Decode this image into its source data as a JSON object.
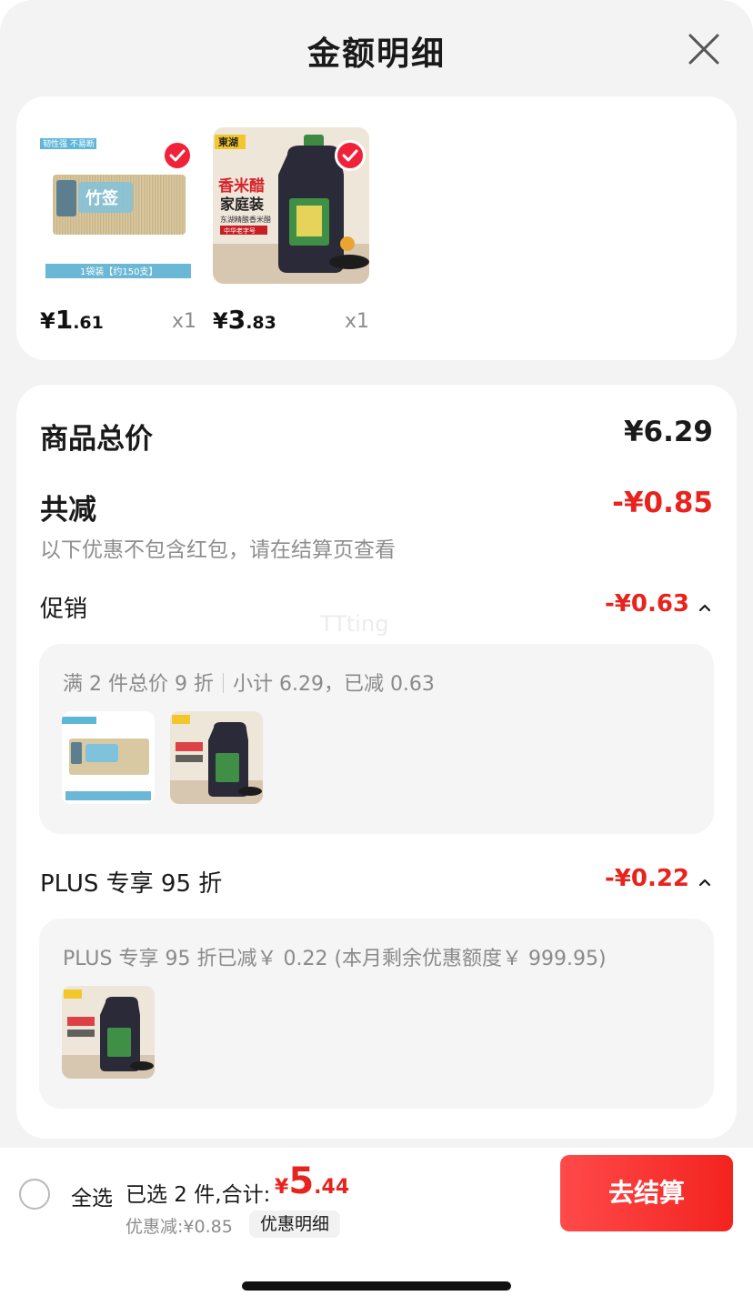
{
  "sheet": {
    "title": "金额明细"
  },
  "products": [
    {
      "name": "竹签",
      "price_symbol": "¥",
      "price_int": "1",
      "price_dec": ".61",
      "qty": "x1",
      "badge": "韧性强 不易断",
      "pack_label": "1袋装【约150支】",
      "brand": "竹签"
    },
    {
      "name": "香米醋家庭装",
      "price_symbol": "¥",
      "price_int": "3",
      "price_dec": ".83",
      "qty": "x1",
      "brand": "東湖",
      "headline1": "香米醋",
      "headline2": "家庭装",
      "sub": "东湖精酿香米醋",
      "tag": "中华老字号"
    }
  ],
  "summary": {
    "total_label": "商品总价",
    "total_value": "¥6.29",
    "reduce_label": "共减",
    "reduce_value": "-¥0.85",
    "reduce_note": "以下优惠不包含红包，请在结算页查看",
    "promo": {
      "label": "促销",
      "value": "-¥0.63",
      "rule": "满 2 件总价 9 折",
      "detail": "小计 6.29，已减 0.63"
    },
    "plus": {
      "label": "PLUS 专享 95 折",
      "value": "-¥0.22",
      "detail": "PLUS 专享 95 折已减￥ 0.22 (本月剩余优惠额度￥ 999.95)"
    }
  },
  "watermark": "TTting",
  "footer": {
    "select_all": "全选",
    "selected_text": "已选 2 件,合计:",
    "total_symbol": "¥",
    "total_int": "5",
    "total_dec": ".44",
    "discount_text": "优惠减:¥0.85",
    "detail_button": "优惠明细",
    "checkout_button": "去结算"
  },
  "colors": {
    "accent_red": "#e8231d",
    "check_red": "#f0223a",
    "sheet_bg": "#f3f3f3"
  },
  "icons": {
    "close": "close-icon",
    "check": "checkmark-icon",
    "caret": "chevron-up-icon"
  }
}
